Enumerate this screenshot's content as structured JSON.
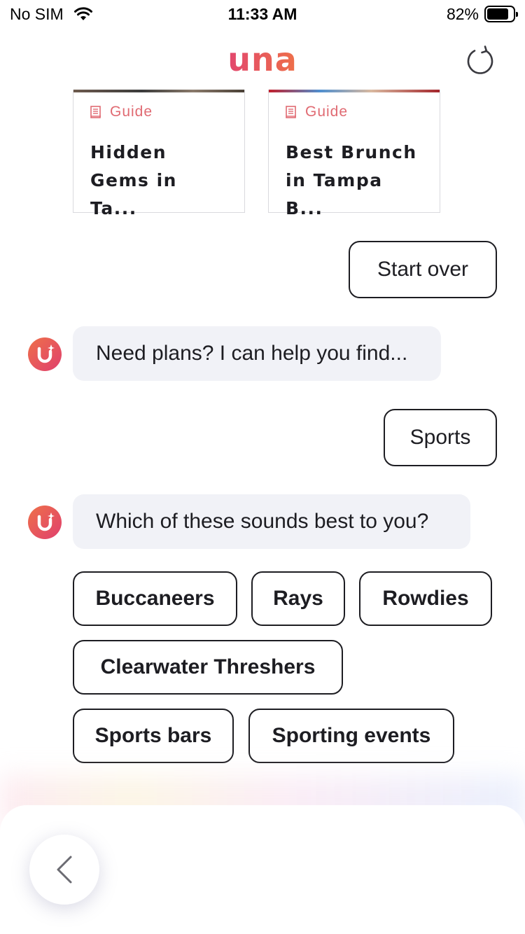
{
  "status_bar": {
    "carrier": "No SIM",
    "time": "11:33 AM",
    "battery": "82%",
    "battery_level": 0.82
  },
  "header": {
    "logo": "una",
    "refresh_icon": "refresh-icon"
  },
  "guide_cards": [
    {
      "tag": "Guide",
      "title": "Hidden Gems in Ta...",
      "icon": "guide-icon"
    },
    {
      "tag": "Guide",
      "title": "Best Brunch in Tampa B...",
      "icon": "guide-icon"
    }
  ],
  "chat": {
    "user_message_1": "Start over",
    "bot_message_1": "Need plans? I can help you find...",
    "user_message_2": "Sports",
    "bot_message_2": "Which of these sounds best to you?"
  },
  "options": [
    "Buccaneers",
    "Rays",
    "Rowdies",
    "Clearwater Threshers",
    "Sports bars",
    "Sporting events"
  ],
  "colors": {
    "accent_start": "#e2476e",
    "accent_end": "#ee7049",
    "tag": "#e06a72",
    "bot_bubble": "#f1f2f7"
  }
}
